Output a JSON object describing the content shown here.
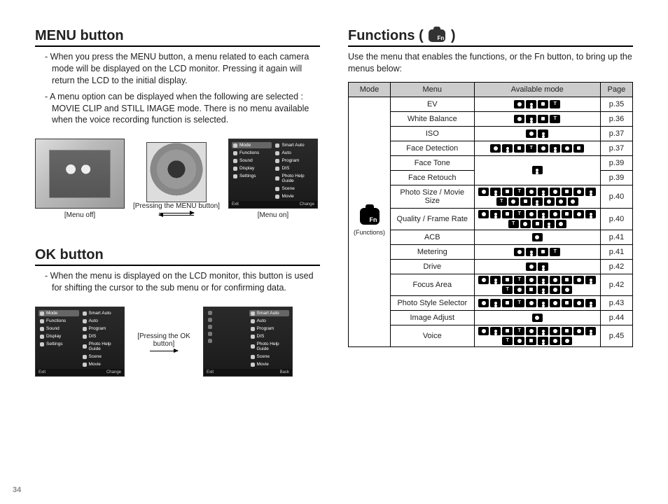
{
  "page_number": "34",
  "left": {
    "menu_heading": "MENU button",
    "menu_para1": "When you press the MENU button, a menu related to each camera mode will be displayed on the LCD monitor. Pressing it again will return the LCD to the initial display.",
    "menu_para2": "A menu option can be displayed when the following are selected : MOVIE CLIP and STILL IMAGE mode. There is no menu available when the voice recording function is selected.",
    "cap_menu_off": "[Menu off]",
    "cap_pressing_menu": "[Pressing the MENU button]",
    "cap_menu_on": "[Menu on]",
    "ok_heading": "OK button",
    "ok_para": "When the menu is displayed on the LCD monitor, this button is used for shifting the cursor to the sub menu or for confirming data.",
    "cap_pressing_ok": "[Pressing the OK button]",
    "menu_screen": {
      "left_items": [
        "Mode",
        "Functions",
        "Sound",
        "Display",
        "Settings"
      ],
      "right_items": [
        "Smart Auto",
        "Auto",
        "Program",
        "DIS",
        "Photo Help Guide",
        "Scene",
        "Movie"
      ],
      "footer_left": "Exit",
      "footer_right_change": "Change",
      "footer_right_back": "Back"
    }
  },
  "right": {
    "fn_heading_prefix": "Functions ( ",
    "fn_heading_suffix": " )",
    "intro": "Use the menu that enables the functions, or the Fn button, to bring up the menus below:",
    "headers": {
      "mode": "Mode",
      "menu": "Menu",
      "avail": "Available mode",
      "page": "Page"
    },
    "mode_label": "(Functions)",
    "rows": [
      {
        "menu": "EV",
        "icons": 4,
        "page": "p.35"
      },
      {
        "menu": "White Balance",
        "icons": 4,
        "page": "p.36"
      },
      {
        "menu": "ISO",
        "icons": 2,
        "page": "p.37"
      },
      {
        "menu": "Face Detection",
        "icons": 8,
        "page": "p.37"
      },
      {
        "menu": "Face Tone",
        "icons": 1,
        "page": "p.39"
      },
      {
        "menu": "Face Retouch",
        "icons": 1,
        "page": "p.39"
      },
      {
        "menu": "Photo Size / Movie Size",
        "icons": 17,
        "page": "p.40"
      },
      {
        "menu": "Quality / Frame Rate",
        "icons": 15,
        "page": "p.40"
      },
      {
        "menu": "ACB",
        "icons": 1,
        "page": "p.41"
      },
      {
        "menu": "Metering",
        "icons": 4,
        "page": "p.41"
      },
      {
        "menu": "Drive",
        "icons": 2,
        "page": "p.42"
      },
      {
        "menu": "Focus Area",
        "icons": 16,
        "page": "p.42"
      },
      {
        "menu": "Photo Style Selector",
        "icons": 10,
        "page": "p.43"
      },
      {
        "menu": "Image Adjust",
        "icons": 1,
        "page": "p.44"
      },
      {
        "menu": "Voice",
        "icons": 16,
        "page": "p.45"
      }
    ]
  }
}
